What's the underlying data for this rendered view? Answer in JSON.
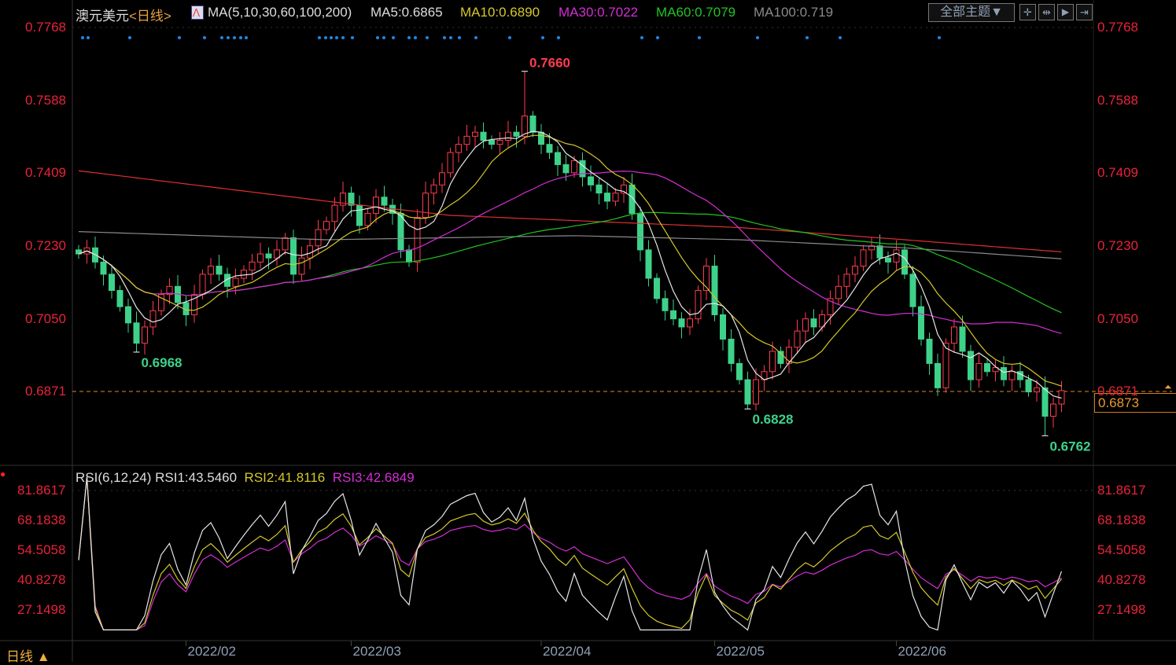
{
  "header": {
    "symbol": "澳元美元",
    "period": "<日线>",
    "ma_label": "MA(5,10,30,60,100,200)",
    "ma5": "MA5:0.6865",
    "ma10": "MA10:0.6890",
    "ma30": "MA30:0.7022",
    "ma60": "MA60:0.7079",
    "ma100": "MA100:0.719"
  },
  "toolbar": {
    "theme_button": "全部主题▼"
  },
  "rsi_header": {
    "label": "RSI(6,12,24)",
    "rsi1": "RSI1:43.5460",
    "rsi2": "RSI2:41.8116",
    "rsi3": "RSI3:42.6849"
  },
  "footer": {
    "period_button": "日线 ▲"
  },
  "current_price": "0.6873",
  "colors": {
    "up": "#ff3b4f",
    "down": "#3ed18a",
    "ma5": "#e6e6e6",
    "ma10": "#d4c82a",
    "ma30": "#d42ed4",
    "ma60": "#22c322",
    "ma100": "#8a8a8a",
    "ma200": "#e03030",
    "axis": "#e8233a"
  },
  "chart_data": [
    {
      "type": "candlestick",
      "title": "澳元美元 日线",
      "price_ticks": [
        "0.7768",
        "0.7588",
        "0.7409",
        "0.7230",
        "0.7050",
        "0.6871"
      ],
      "ylim": [
        0.6871,
        0.7768
      ],
      "date_ticks": [
        {
          "label": "2022/02",
          "index": 13
        },
        {
          "label": "2022/03",
          "index": 33
        },
        {
          "label": "2022/04",
          "index": 56
        },
        {
          "label": "2022/05",
          "index": 77
        },
        {
          "label": "2022/06",
          "index": 99
        }
      ],
      "close": [
        0.721,
        0.7225,
        0.719,
        0.716,
        0.712,
        0.708,
        0.704,
        0.699,
        0.703,
        0.707,
        0.711,
        0.713,
        0.709,
        0.706,
        0.711,
        0.716,
        0.718,
        0.716,
        0.713,
        0.715,
        0.717,
        0.719,
        0.721,
        0.72,
        0.722,
        0.725,
        0.716,
        0.72,
        0.723,
        0.727,
        0.729,
        0.733,
        0.736,
        0.733,
        0.728,
        0.731,
        0.735,
        0.733,
        0.731,
        0.722,
        0.719,
        0.73,
        0.736,
        0.738,
        0.741,
        0.746,
        0.748,
        0.75,
        0.751,
        0.749,
        0.748,
        0.749,
        0.751,
        0.75,
        0.755,
        0.751,
        0.748,
        0.746,
        0.743,
        0.741,
        0.744,
        0.74,
        0.738,
        0.736,
        0.734,
        0.736,
        0.738,
        0.731,
        0.722,
        0.715,
        0.71,
        0.707,
        0.705,
        0.703,
        0.705,
        0.712,
        0.718,
        0.706,
        0.7,
        0.694,
        0.69,
        0.684,
        0.69,
        0.692,
        0.697,
        0.694,
        0.698,
        0.702,
        0.705,
        0.703,
        0.706,
        0.71,
        0.713,
        0.716,
        0.718,
        0.722,
        0.723,
        0.72,
        0.719,
        0.722,
        0.716,
        0.708,
        0.7,
        0.694,
        0.688,
        0.699,
        0.703,
        0.697,
        0.69,
        0.694,
        0.692,
        0.693,
        0.69,
        0.692,
        0.69,
        0.687,
        0.688,
        0.681,
        0.684,
        0.6873
      ],
      "annotations": [
        {
          "label": "0.7660",
          "index": 54,
          "value": 0.766,
          "kind": "high"
        },
        {
          "label": "0.6968",
          "index": 7,
          "value": 0.6968,
          "kind": "low"
        },
        {
          "label": "0.6828",
          "index": 81,
          "value": 0.6828,
          "kind": "low"
        },
        {
          "label": "0.6762",
          "index": 117,
          "value": 0.6762,
          "kind": "low"
        }
      ],
      "ma100": [
        [
          0,
          0.7265
        ],
        [
          30,
          0.7245
        ],
        [
          60,
          0.7255
        ],
        [
          80,
          0.7245
        ],
        [
          100,
          0.7225
        ],
        [
          119,
          0.7198
        ]
      ],
      "ma200": [
        [
          0,
          0.7415
        ],
        [
          30,
          0.734
        ],
        [
          45,
          0.7305
        ],
        [
          80,
          0.7275
        ],
        [
          100,
          0.7245
        ],
        [
          119,
          0.7215
        ]
      ]
    },
    {
      "type": "line",
      "title": "RSI(6,12,24)",
      "series": [
        "RSI1",
        "RSI2",
        "RSI3"
      ],
      "periods": [
        6,
        12,
        24
      ],
      "ticks": [
        "81.8617",
        "68.1838",
        "54.5058",
        "40.8278",
        "27.1498"
      ],
      "ylim": [
        27.1498,
        81.8617
      ]
    }
  ]
}
